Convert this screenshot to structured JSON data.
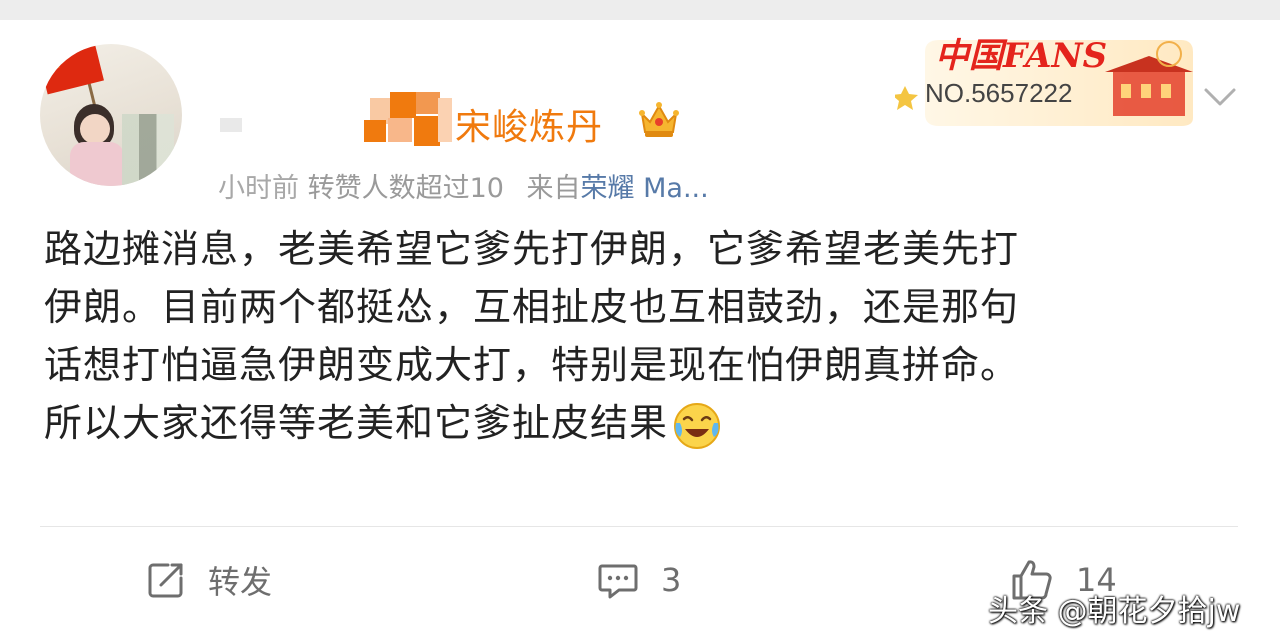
{
  "post": {
    "author": {
      "username": "宋峻炼丹",
      "meta_time": "小时前",
      "meta_reposts": "转赞人数超过10",
      "meta_source_prefix": "来自",
      "meta_device": "荣耀 Ma..."
    },
    "badge": {
      "title": "中国FANS",
      "number": "NO.5657222"
    },
    "content": {
      "lines": [
        "路边摊消息，老美希望它爹先打伊朗，它爹希望老美先打",
        "伊朗。目前两个都挺怂，互相扯皮也互相鼓劲，还是那句",
        "话想打怕逼急伊朗变成大打，特别是现在怕伊朗真拼命。",
        "所以大家还得等老美和它爹扯皮结果"
      ],
      "emoji": "laugh-cry-emoji"
    },
    "actions": {
      "repost_label": "转发",
      "comment_count": "3",
      "like_count": "14"
    }
  },
  "watermark": "头条 @朝花夕拾jw",
  "colors": {
    "username": "#f07a0e",
    "text": "#222222",
    "meta": "#9a9a9a",
    "action": "#6e6e6e",
    "badge_red": "#e4241c"
  }
}
